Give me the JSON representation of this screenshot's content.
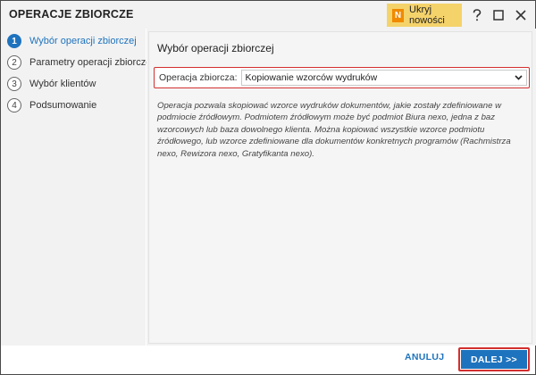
{
  "window": {
    "title": "OPERACJE ZBIORCZE",
    "hide_news": {
      "icon_letter": "N",
      "label": "Ukryj nowości"
    }
  },
  "steps": [
    {
      "number": "1",
      "label": "Wybór operacji zbiorczej",
      "active": true
    },
    {
      "number": "2",
      "label": "Parametry operacji zbiorczej",
      "active": false
    },
    {
      "number": "3",
      "label": "Wybór klientów",
      "active": false
    },
    {
      "number": "4",
      "label": "Podsumowanie",
      "active": false
    }
  ],
  "main": {
    "section_title": "Wybór operacji zbiorczej",
    "operation": {
      "label": "Operacja zbiorcza:",
      "value": "Kopiowanie wzorców wydruków"
    },
    "description": "Operacja pozwala skopiować wzorce wydruków dokumentów, jakie zostały zdefiniowane w podmiocie źródłowym. Podmiotem źródłowym może być podmiot Biura nexo, jedna z baz wzorcowych lub baza dowolnego klienta. Można kopiować wszystkie wzorce podmiotu źródłowego, lub wzorce zdefiniowane dla dokumentów konkretnych programów (Rachmistrza nexo, Rewizora nexo, Gratyfikanta nexo)."
  },
  "footer": {
    "cancel_label": "ANULUJ",
    "next_label": "DALEJ >>"
  },
  "colors": {
    "accent": "#1e73be",
    "highlight_border": "#d32f2f",
    "news_bg": "#f5d36b",
    "news_icon": "#f08a00"
  }
}
